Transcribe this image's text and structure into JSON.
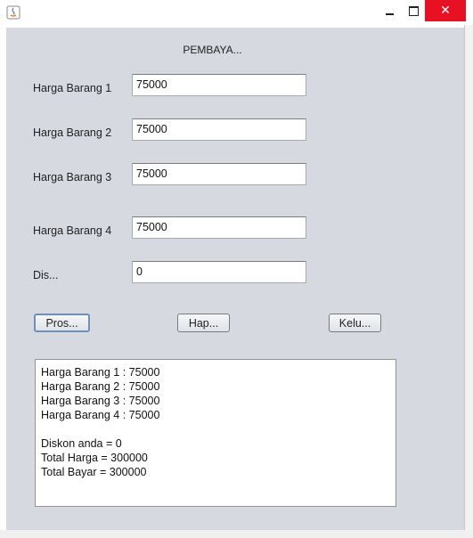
{
  "window": {
    "title": "",
    "close_glyph": "✕"
  },
  "heading": "PEMBAYA...",
  "fields": [
    {
      "label": "Harga Barang 1",
      "value": "75000"
    },
    {
      "label": "Harga Barang 2",
      "value": "75000"
    },
    {
      "label": "Harga Barang 3",
      "value": "75000"
    },
    {
      "label": "Harga Barang 4",
      "value": "75000"
    },
    {
      "label": "Dis...",
      "value": "0"
    }
  ],
  "buttons": {
    "process": "Pros...",
    "clear": "Hap...",
    "exit": "Kelu..."
  },
  "output": {
    "lines": [
      "Harga Barang 1 : 75000",
      "Harga Barang 2 : 75000",
      "Harga Barang 3 : 75000",
      "Harga Barang 4 : 75000",
      "",
      "Diskon anda = 0",
      "Total Harga = 300000",
      "Total Bayar = 300000"
    ]
  },
  "colors": {
    "panel": "#d6d9e0",
    "close": "#e81123"
  }
}
